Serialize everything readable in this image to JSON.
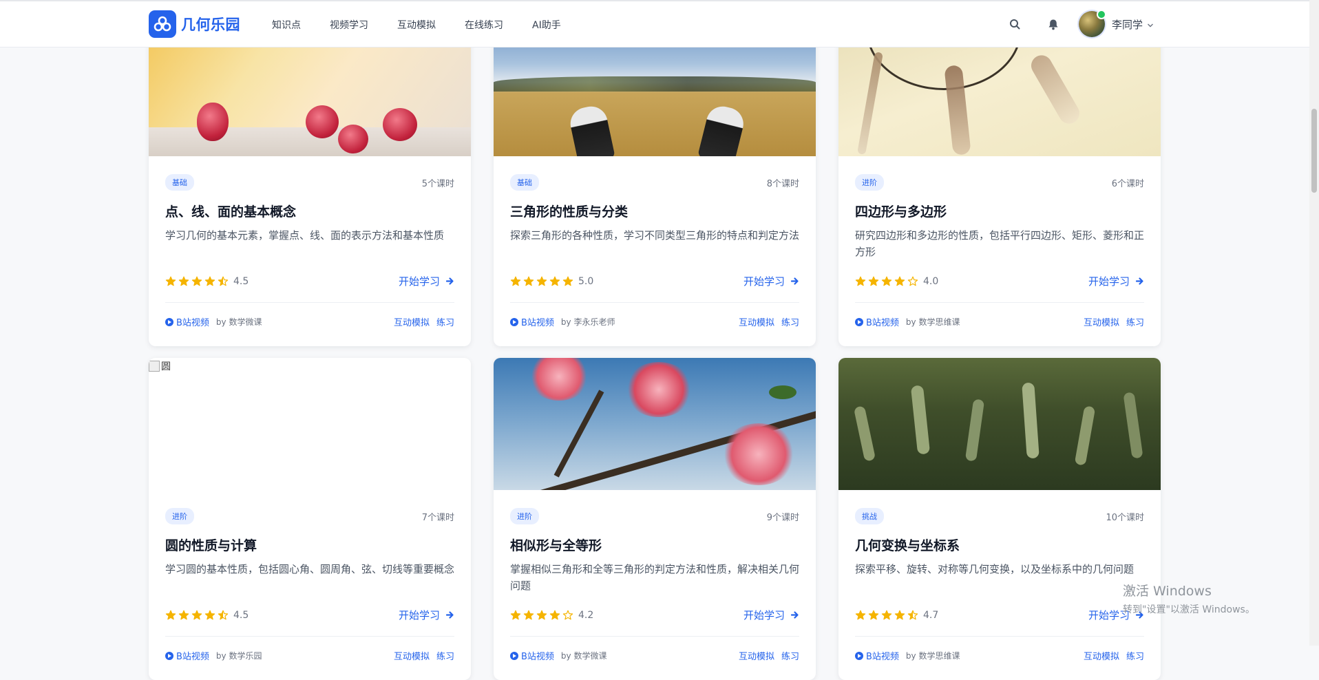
{
  "brand": {
    "name": "几何乐园",
    "color": "#2563eb"
  },
  "nav": [
    "知识点",
    "视频学习",
    "互动模拟",
    "在线练习",
    "AI助手"
  ],
  "user": {
    "name": "李同学"
  },
  "icons": {
    "search": "search-icon",
    "bell": "bell-icon",
    "caret": "chevron-down-icon"
  },
  "cards": [
    {
      "level": "基础",
      "lessons": "5个课时",
      "title": "点、线、面的基本概念",
      "desc": "学习几何的基本元素，掌握点、线、面的表示方法和基本性质",
      "rating": "4.5",
      "stars": 4.5,
      "start": "开始学习",
      "video": "B站视频",
      "author": "by 数学微课",
      "sim": "互动模拟",
      "practice": "练习"
    },
    {
      "level": "基础",
      "lessons": "8个课时",
      "title": "三角形的性质与分类",
      "desc": "探索三角形的各种性质，学习不同类型三角形的特点和判定方法",
      "rating": "5.0",
      "stars": 5,
      "start": "开始学习",
      "video": "B站视频",
      "author": "by 李永乐老师",
      "sim": "互动模拟",
      "practice": "练习"
    },
    {
      "level": "进阶",
      "lessons": "6个课时",
      "title": "四边形与多边形",
      "desc": "研究四边形和多边形的性质，包括平行四边形、矩形、菱形和正方形",
      "rating": "4.0",
      "stars": 4,
      "start": "开始学习",
      "video": "B站视频",
      "author": "by 数学思维课",
      "sim": "互动模拟",
      "practice": "练习"
    },
    {
      "level": "进阶",
      "lessons": "7个课时",
      "title": "圆的性质与计算",
      "desc": "学习圆的基本性质，包括圆心角、圆周角、弦、切线等重要概念",
      "rating": "4.5",
      "stars": 4.5,
      "start": "开始学习",
      "video": "B站视频",
      "author": "by 数学乐园",
      "sim": "互动模拟",
      "practice": "练习",
      "img_alt": "圆"
    },
    {
      "level": "进阶",
      "lessons": "9个课时",
      "title": "相似形与全等形",
      "desc": "掌握相似三角形和全等三角形的判定方法和性质，解决相关几何问题",
      "rating": "4.2",
      "stars": 4,
      "start": "开始学习",
      "video": "B站视频",
      "author": "by 数学微课",
      "sim": "互动模拟",
      "practice": "练习"
    },
    {
      "level": "挑战",
      "lessons": "10个课时",
      "title": "几何变换与坐标系",
      "desc": "探索平移、旋转、对称等几何变换，以及坐标系中的几何问题",
      "rating": "4.7",
      "stars": 4.5,
      "start": "开始学习",
      "video": "B站视频",
      "author": "by 数学思维课",
      "sim": "互动模拟",
      "practice": "练习"
    }
  ],
  "watermark": {
    "line1": "激活 Windows",
    "line2": "转到\"设置\"以激活 Windows。"
  }
}
